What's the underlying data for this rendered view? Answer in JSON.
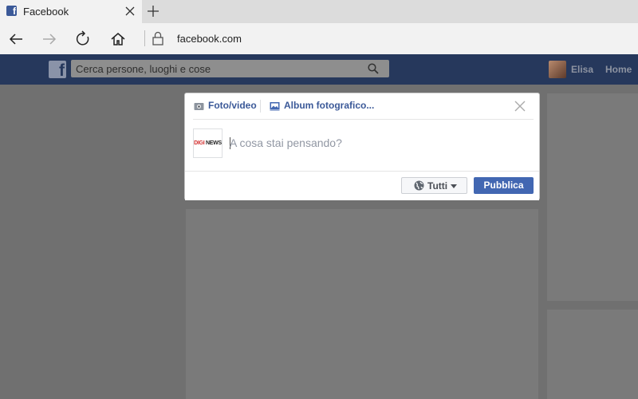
{
  "browser": {
    "tab_title": "Facebook",
    "favicon": "facebook-icon",
    "url": "facebook.com"
  },
  "facebook": {
    "search_placeholder": "Cerca persone, luoghi e cose",
    "user_name": "Elisa",
    "home_label": "Home"
  },
  "composer": {
    "tab_photo": "Foto/video",
    "tab_album": "Album fotografico...",
    "page_logo_text_1": "DIGI",
    "page_logo_text_2": "NEWS",
    "status_placeholder": "A cosa stai pensando?",
    "audience_label": "Tutti",
    "publish_label": "Pubblica"
  },
  "colors": {
    "facebook_blue": "#3b5998",
    "header": "#26385c",
    "publish_button": "#4267b2"
  }
}
